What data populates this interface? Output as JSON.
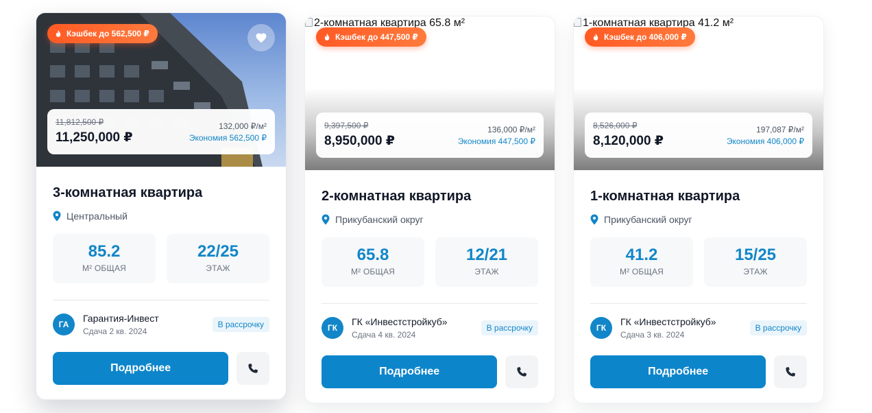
{
  "listings": [
    {
      "image_alt": "",
      "cashback": "Кэшбек до 562,500 ₽",
      "has_favorite": true,
      "old_price": "11,812,500 ₽",
      "price": "11,250,000 ₽",
      "price_per_m2": "132,000 ₽/м²",
      "savings": "Экономия 562,500 ₽",
      "title": "3-комнатная квартира",
      "location": "Центральный",
      "area_value": "85.2",
      "area_label": "М² ОБЩАЯ",
      "floor_value": "22/25",
      "floor_label": "ЭТАЖ",
      "developer_initials": "ГА",
      "developer_name": "Гарантия-Инвест",
      "delivery": "Сдача 2 кв. 2024",
      "installment": "В рассрочку",
      "details_label": "Подробнее"
    },
    {
      "image_alt": "2-комнатная квартира 65.8 м²",
      "cashback": "Кэшбек до 447,500 ₽",
      "has_favorite": false,
      "old_price": "9,397,500 ₽",
      "price": "8,950,000 ₽",
      "price_per_m2": "136,000 ₽/м²",
      "savings": "Экономия 447,500 ₽",
      "title": "2-комнатная квартира",
      "location": "Прикубанский округ",
      "area_value": "65.8",
      "area_label": "М² ОБЩАЯ",
      "floor_value": "12/21",
      "floor_label": "ЭТАЖ",
      "developer_initials": "ГК",
      "developer_name": "ГК «Инвестстройкуб»",
      "delivery": "Сдача 4 кв. 2024",
      "installment": "В рассрочку",
      "details_label": "Подробнее"
    },
    {
      "image_alt": "1-комнатная квартира 41.2 м²",
      "cashback": "Кэшбек до 406,000 ₽",
      "has_favorite": false,
      "old_price": "8,526,000 ₽",
      "price": "8,120,000 ₽",
      "price_per_m2": "197,087 ₽/м²",
      "savings": "Экономия 406,000 ₽",
      "title": "1-комнатная квартира",
      "location": "Прикубанский округ",
      "area_value": "41.2",
      "area_label": "М² ОБЩАЯ",
      "floor_value": "15/25",
      "floor_label": "ЭТАЖ",
      "developer_initials": "ГК",
      "developer_name": "ГК «Инвестстройкуб»",
      "delivery": "Сдача 3 кв. 2024",
      "installment": "В рассрочку",
      "details_label": "Подробнее"
    }
  ],
  "colors": {
    "accent": "#0d85cb",
    "value_blue": "#1286c8",
    "cashback": "#ff5a24",
    "text": "#111827",
    "muted": "#6b7280"
  },
  "icons": {
    "cashback": "fire-icon",
    "favorite": "heart-icon",
    "location": "map-pin-icon",
    "call": "phone-icon"
  }
}
